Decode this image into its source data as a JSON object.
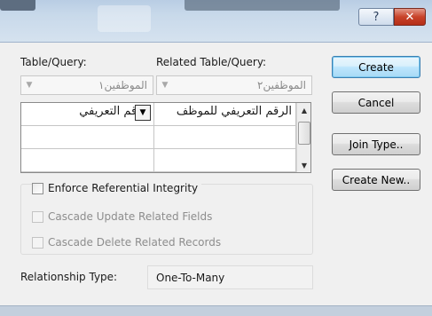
{
  "window": {
    "help_glyph": "?",
    "close_glyph": "✕"
  },
  "labels": {
    "table_query": "Table/Query:",
    "related_table_query": "Related Table/Query:"
  },
  "table_select": {
    "value": "الموظفين١",
    "arrow": "chevron-down-icon"
  },
  "related_select": {
    "value": "الموظفين٢",
    "arrow": "chevron-down-icon"
  },
  "grid": {
    "rows": [
      {
        "left": "الرقم التعريفي",
        "right": "الرقم التعريفي للموظف"
      },
      {
        "left": "",
        "right": ""
      },
      {
        "left": "",
        "right": ""
      }
    ]
  },
  "options": {
    "enforce_integrity": "Enforce Referential Integrity",
    "cascade_update": "Cascade Update Related Fields",
    "cascade_delete": "Cascade Delete Related Records"
  },
  "relationship": {
    "label": "Relationship Type:",
    "value": "One-To-Many"
  },
  "buttons": {
    "create": "Create",
    "cancel": "Cancel",
    "join_type": "Join Type..",
    "create_new": "Create New.."
  }
}
